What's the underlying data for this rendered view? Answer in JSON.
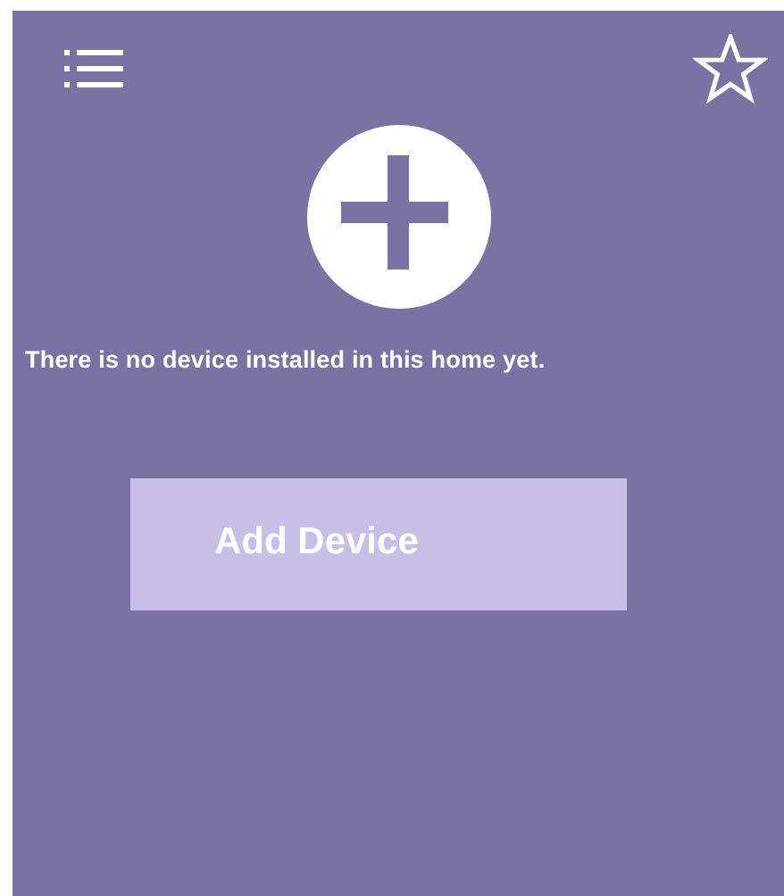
{
  "header": {
    "starred": false
  },
  "empty_state": {
    "message": "There is no device installed in this home yet."
  },
  "buttons": [
    {
      "label": "Add Device"
    }
  ]
}
